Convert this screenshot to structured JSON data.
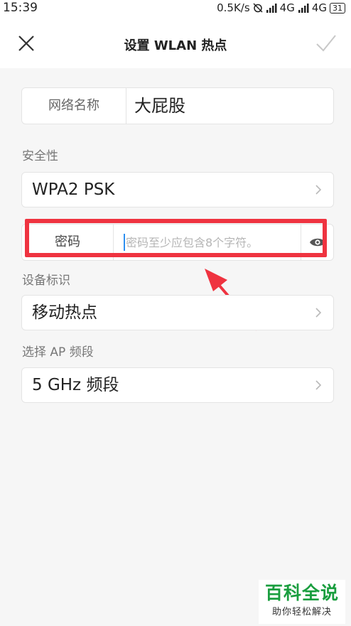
{
  "status": {
    "time": "15:39",
    "right_text": "0.5K/s",
    "net1": "4G",
    "net2": "4G",
    "battery": "31"
  },
  "header": {
    "title": "设置 WLAN 热点"
  },
  "ssid": {
    "label": "网络名称",
    "value": "大屁股"
  },
  "security": {
    "section_label": "安全性",
    "value": "WPA2 PSK"
  },
  "password": {
    "label": "密码",
    "placeholder": "密码至少应包含8个字符。"
  },
  "device_id": {
    "section_label": "设备标识",
    "value": "移动热点"
  },
  "band": {
    "section_label": "选择 AP 频段",
    "value": "5 GHz 频段"
  },
  "watermark": {
    "main": "百科全说",
    "sub": "助你轻松解决"
  },
  "colors": {
    "accent_highlight": "#ef3340",
    "watermark_green": "#1a9e3f",
    "caret_blue": "#2d8ff0"
  }
}
